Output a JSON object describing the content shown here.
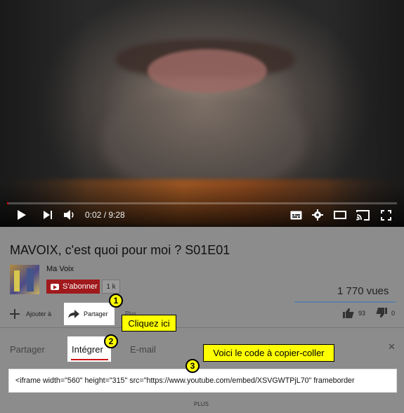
{
  "player": {
    "time": "0:02 / 9:28",
    "progress_fraction": 0.0035
  },
  "video": {
    "title": "MAVOIX, c'est quoi pour moi ? S01E01"
  },
  "channel": {
    "name": "Ma Voix",
    "subscribe_label": "S'abonner",
    "subscriber_count": "1 k"
  },
  "stats": {
    "views": "1 770 vues",
    "likes": "93",
    "dislikes": "0"
  },
  "actions": {
    "add_to": "Ajouter à",
    "share": "Partager",
    "more": "Plus"
  },
  "share_panel": {
    "tabs": [
      "Partager",
      "Intégrer",
      "E-mail"
    ],
    "embed_code": "<iframe width=\"560\" height=\"315\" src=\"https://www.youtube.com/embed/XSVGWTPjL70\" frameborder",
    "more_label": "PLUS"
  },
  "annotations": {
    "step1": "1",
    "step2": "2",
    "step3": "3",
    "callout1": "Cliquez ici",
    "callout3": "Voici le code à copier-coller"
  },
  "colors": {
    "brand_red": "#c00",
    "highlight": "#ffff00",
    "link_blue": "#5d7fa6"
  },
  "icons": {
    "play": "play-icon",
    "next": "next-icon",
    "volume": "volume-icon",
    "captions": "captions-icon",
    "settings": "gear-icon",
    "theater": "theater-icon",
    "cast": "cast-icon",
    "fullscreen": "fullscreen-icon",
    "share": "share-arrow-icon",
    "like": "thumbs-up-icon",
    "dislike": "thumbs-down-icon",
    "add": "plus-icon",
    "close": "close-icon"
  }
}
